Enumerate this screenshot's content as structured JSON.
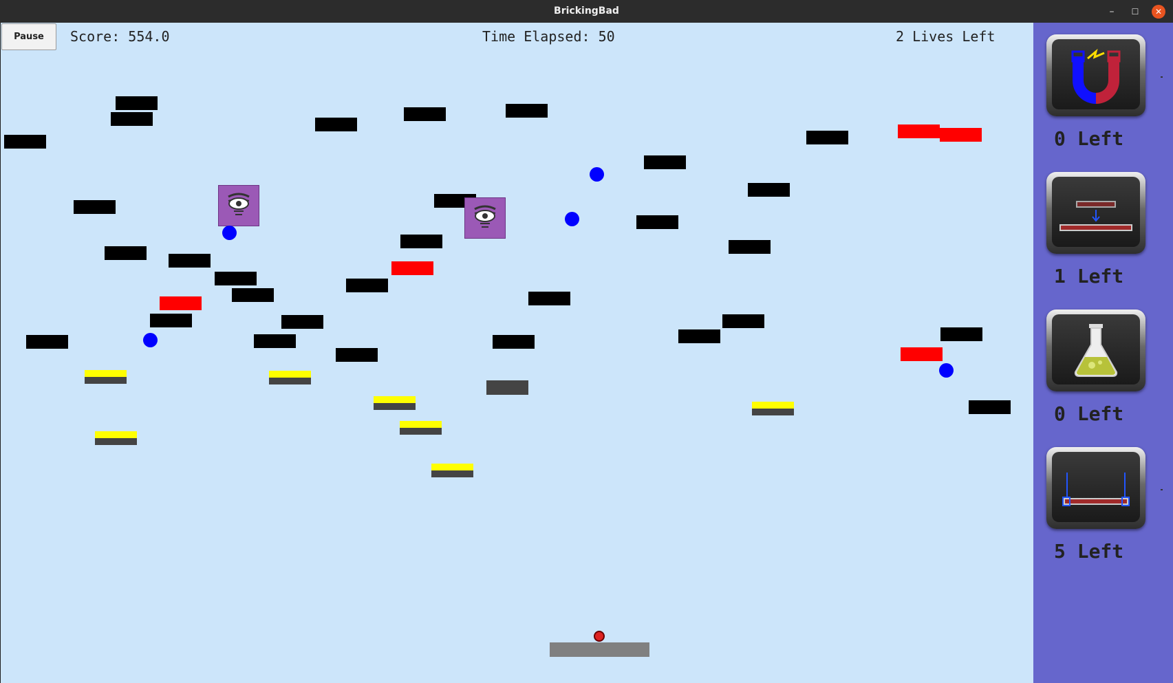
{
  "window": {
    "title": "BrickingBad"
  },
  "hud": {
    "pause_label": "Pause",
    "score": "Score: 554.0",
    "time": "Time Elapsed: 50",
    "lives": "2 Lives Left"
  },
  "colors": {
    "background": "#cce5fa",
    "sidebar": "#6666cc",
    "simple_brick": "#000000",
    "red_brick": "#ff0000",
    "enemy": "#9b59b6",
    "ball": "#0000ff"
  },
  "powerups": [
    {
      "name": "magnet",
      "icon": "magnet-icon",
      "label": "0 Left"
    },
    {
      "name": "paddle-expansion",
      "icon": "paddle-expand-icon",
      "label": "1 Left"
    },
    {
      "name": "chemical-ball",
      "icon": "flask-icon",
      "label": "0 Left"
    },
    {
      "name": "hex-paddle",
      "icon": "laser-paddle-icon",
      "label": "5 Left"
    }
  ]
}
